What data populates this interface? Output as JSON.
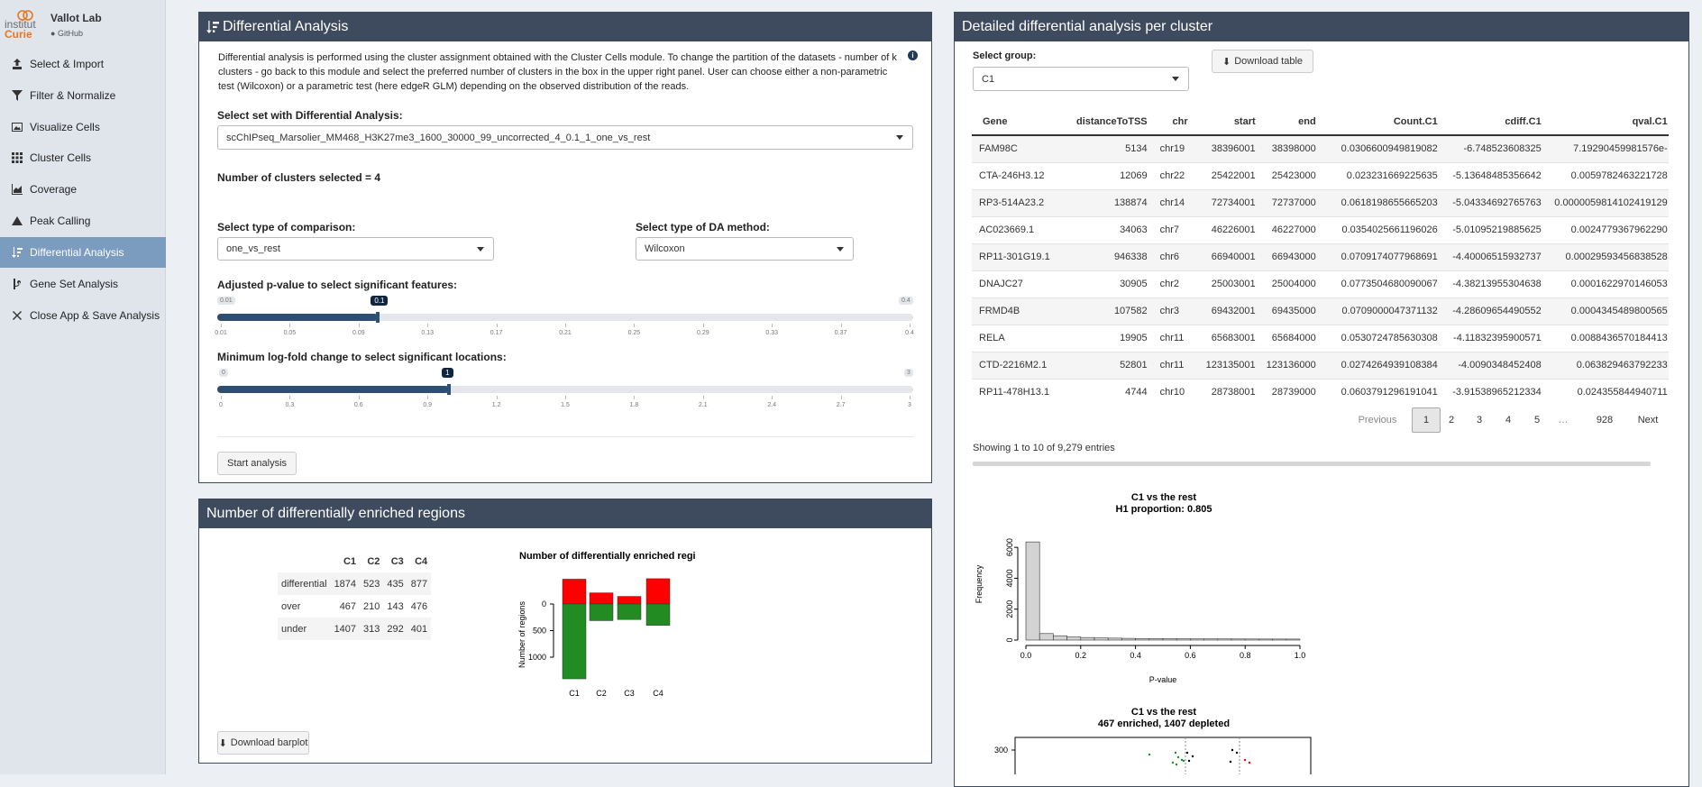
{
  "sidebar": {
    "logo": {
      "line1": "institut",
      "line2": "Curie",
      "lab": "Vallot Lab",
      "github": "GitHub"
    },
    "items": [
      {
        "label": "Select & Import",
        "icon": "upload-icon"
      },
      {
        "label": "Filter & Normalize",
        "icon": "filter-icon"
      },
      {
        "label": "Visualize Cells",
        "icon": "image-icon"
      },
      {
        "label": "Cluster Cells",
        "icon": "grid-icon"
      },
      {
        "label": "Coverage",
        "icon": "area-chart-icon"
      },
      {
        "label": "Peak Calling",
        "icon": "mountain-icon"
      },
      {
        "label": "Differential Analysis",
        "icon": "sort-amount-icon",
        "active": true
      },
      {
        "label": "Gene Set Analysis",
        "icon": "code-branch-icon"
      },
      {
        "label": "Close App & Save Analysis",
        "icon": "close-icon"
      }
    ]
  },
  "da": {
    "title": "Differential Analysis",
    "description": "Differential analysis is performed using the cluster assignment obtained with the Cluster Cells module. To change the partition of the datasets - number of k clusters - go back to this module and select the preferred number of clusters in the box in the upper right panel. User can choose either a non-parametric test (Wilcoxon) or a parametric test (here edgeR GLM) depending on the observed distribution of the reads.",
    "select_set_label": "Select set with Differential Analysis:",
    "select_set_value": "scChIPseq_Marsolier_MM468_H3K27me3_1600_30000_99_uncorrected_4_0.1_1_one_vs_rest",
    "n_clusters_text": "Number of clusters selected = 4",
    "comparison_label": "Select type of comparison:",
    "comparison_value": "one_vs_rest",
    "method_label": "Select type of DA method:",
    "method_value": "Wilcoxon",
    "pval_label": "Adjusted p-value to select significant features:",
    "pval": {
      "min": "0.01",
      "max": "0.4",
      "value": "0.1",
      "fraction": 0.231,
      "ticks": [
        "0.01",
        "0.05",
        "0.09",
        "0.13",
        "0.17",
        "0.21",
        "0.25",
        "0.29",
        "0.33",
        "0.37",
        "0.4"
      ]
    },
    "logfc_label": "Minimum log-fold change to select significant locations:",
    "logfc": {
      "min": "0",
      "max": "3",
      "value": "1",
      "fraction": 0.333,
      "ticks": [
        "0",
        "0.3",
        "0.6",
        "0.9",
        "1.2",
        "1.5",
        "1.8",
        "2.1",
        "2.4",
        "2.7",
        "3"
      ]
    },
    "start_button": "Start analysis"
  },
  "regions": {
    "title": "Number of differentially enriched regions",
    "columns": [
      "",
      "C1",
      "C2",
      "C3",
      "C4"
    ],
    "rows": [
      [
        "differential",
        "1874",
        "523",
        "435",
        "877"
      ],
      [
        "over",
        "467",
        "210",
        "143",
        "476"
      ],
      [
        "under",
        "1407",
        "313",
        "292",
        "401"
      ]
    ],
    "download_label": "Download barplot"
  },
  "barplot": {
    "title": "Number of differentially enriched regi",
    "ylabel": "Number of regions",
    "yticks": [
      "0",
      "500",
      "1000"
    ],
    "categories": [
      "C1",
      "C2",
      "C3",
      "C4"
    ],
    "over": [
      467,
      210,
      143,
      476
    ],
    "under": [
      1407,
      313,
      292,
      401
    ],
    "colors": {
      "over": "#ff0000",
      "under": "#228b22"
    }
  },
  "detail": {
    "title": "Detailed differential analysis per cluster",
    "group_label": "Select group:",
    "group_value": "C1",
    "download_label": "Download table",
    "columns": [
      "Gene",
      "distanceToTSS",
      "chr",
      "start",
      "end",
      "Count.C1",
      "cdiff.C1",
      "qval.C1"
    ],
    "rows": [
      [
        "FAM98C",
        "5134",
        "chr19",
        "38396001",
        "38398000",
        "0.0306600949819082",
        "-6.748523608325",
        "7.19290459981576e-"
      ],
      [
        "CTA-246H3.12",
        "12069",
        "chr22",
        "25422001",
        "25423000",
        "0.023231669225635",
        "-5.13648485356642",
        "0.0059782463221728"
      ],
      [
        "RP3-514A23.2",
        "138874",
        "chr14",
        "72734001",
        "72737000",
        "0.0618198655665203",
        "-5.04334692765763",
        "0.0000059814102419129"
      ],
      [
        "AC023669.1",
        "34063",
        "chr7",
        "46226001",
        "46227000",
        "0.0354025661196026",
        "-5.01095219885625",
        "0.0024779367962290"
      ],
      [
        "RP11-301G19.1",
        "946338",
        "chr6",
        "66940001",
        "66943000",
        "0.0709174077968691",
        "-4.40006515932737",
        "0.00029593456838528"
      ],
      [
        "DNAJC27",
        "30905",
        "chr2",
        "25003001",
        "25004000",
        "0.0773504680090067",
        "-4.38213955304638",
        "0.0001622970146053"
      ],
      [
        "FRMD4B",
        "107582",
        "chr3",
        "69432001",
        "69435000",
        "0.0709000047371132",
        "-4.28609654490552",
        "0.0004345489800565"
      ],
      [
        "RELA",
        "19905",
        "chr11",
        "65683001",
        "65684000",
        "0.0530724785630308",
        "-4.11832395900571",
        "0.0088436570184413"
      ],
      [
        "CTD-2216M2.1",
        "52801",
        "chr11",
        "123135001",
        "123136000",
        "0.0274264939108384",
        "-4.0090348452408",
        "0.063829463792233"
      ],
      [
        "RP11-478H13.1",
        "4744",
        "chr10",
        "28738001",
        "28739000",
        "0.0603791296191041",
        "-3.91538965212334",
        "0.024355844940711"
      ]
    ],
    "pagination": [
      "Previous",
      "1",
      "2",
      "3",
      "4",
      "5",
      "…",
      "928",
      "Next"
    ],
    "info": "Showing 1 to 10 of 9,279 entries"
  },
  "histogram": {
    "title1": "C1 vs the rest",
    "title2": "H1 proportion: 0.805",
    "xlabel": "P-value",
    "ylabel": "Frequency",
    "xticks": [
      "0.0",
      "0.2",
      "0.4",
      "0.6",
      "0.8",
      "1.0"
    ],
    "yticks": [
      "0",
      "2000",
      "4000",
      "6000"
    ],
    "ymax": 7000,
    "values": [
      6350,
      420,
      280,
      200,
      165,
      140,
      125,
      110,
      100,
      95,
      90,
      85,
      80,
      78,
      75,
      72,
      70,
      68,
      66,
      64
    ]
  },
  "volcano": {
    "title1": "C1 vs the rest",
    "title2": "467 enriched, 1407 depleted",
    "ytick": "300"
  },
  "chart_data": [
    {
      "type": "bar",
      "title": "Number of differentially enriched regi",
      "ylabel": "Number of regions",
      "categories": [
        "C1",
        "C2",
        "C3",
        "C4"
      ],
      "series": [
        {
          "values": [
            467,
            210,
            143,
            476
          ]
        },
        {
          "values": [
            -1407,
            -313,
            -292,
            -401
          ]
        }
      ]
    },
    {
      "type": "bar",
      "title": "C1 vs the rest",
      "xlabel": "P-value",
      "ylabel": "Frequency",
      "values": [
        6350,
        420,
        280,
        200,
        165,
        140,
        125,
        110,
        100,
        95,
        90,
        85,
        80,
        78,
        75,
        72,
        70,
        68,
        66,
        64
      ],
      "xlim": [
        0,
        1
      ],
      "ylim": [
        0,
        7000
      ]
    }
  ]
}
